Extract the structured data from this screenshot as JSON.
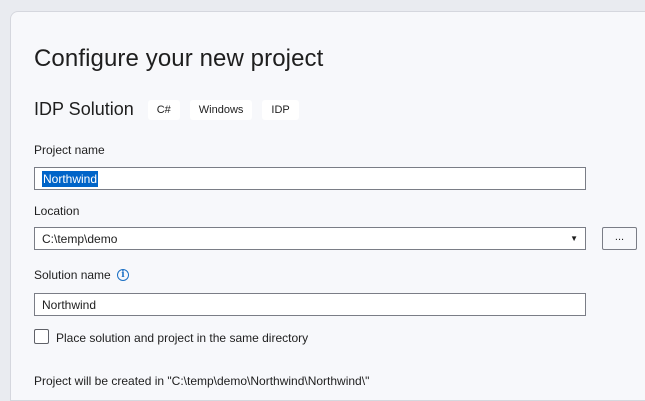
{
  "dialog": {
    "title": "Configure your new project",
    "template": {
      "name": "IDP Solution",
      "tags": [
        "C#",
        "Windows",
        "IDP"
      ]
    },
    "project_name": {
      "label": "Project name",
      "value": "Northwind"
    },
    "location": {
      "label": "Location",
      "value": "C:\\temp\\demo",
      "browse_label": "..."
    },
    "solution_name": {
      "label": "Solution name",
      "value": "Northwind"
    },
    "same_directory": {
      "label": "Place solution and project in the same directory",
      "checked": false
    },
    "path_note": "Project will be created in \"C:\\temp\\demo\\Northwind\\Northwind\\\""
  }
}
